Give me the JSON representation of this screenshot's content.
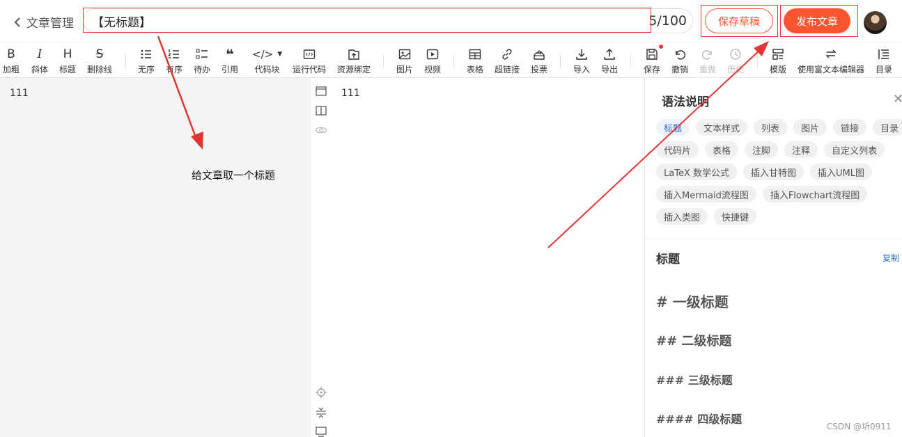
{
  "header": {
    "back_label": "文章管理",
    "title_value": "【无标题】",
    "title_count": "5/100",
    "save_draft_label": "保存草稿",
    "publish_label": "发布文章"
  },
  "toolbar": {
    "items": [
      {
        "icon": "B",
        "label": "加粗"
      },
      {
        "icon": "I",
        "label": "斜体"
      },
      {
        "icon": "H",
        "label": "标题"
      },
      {
        "icon": "S",
        "label": "删除线"
      },
      {
        "icon": "unordered-list",
        "label": "无序"
      },
      {
        "icon": "ordered-list",
        "label": "有序"
      },
      {
        "icon": "todo-list",
        "label": "待办"
      },
      {
        "icon": "quote",
        "label": "引用"
      },
      {
        "icon": "code",
        "label": "代码块"
      },
      {
        "icon": "run-code",
        "label": "运行代码"
      },
      {
        "icon": "resource-bind",
        "label": "资源绑定"
      },
      {
        "icon": "image",
        "label": "图片"
      },
      {
        "icon": "video",
        "label": "视频"
      },
      {
        "icon": "table",
        "label": "表格"
      },
      {
        "icon": "link",
        "label": "超链接"
      },
      {
        "icon": "vote",
        "label": "投票"
      },
      {
        "icon": "import",
        "label": "导入"
      },
      {
        "icon": "export",
        "label": "导出"
      },
      {
        "icon": "save",
        "label": "保存"
      },
      {
        "icon": "undo",
        "label": "撤销"
      },
      {
        "icon": "redo",
        "label": "重做"
      },
      {
        "icon": "history",
        "label": "历史"
      },
      {
        "icon": "template",
        "label": "模版"
      },
      {
        "icon": "switch",
        "label": "使用富文本编辑器"
      },
      {
        "icon": "toc",
        "label": "目录"
      }
    ]
  },
  "editor": {
    "content": "111",
    "annotation": "给文章取一个标题"
  },
  "preview": {
    "content": "111"
  },
  "panel": {
    "title": "语法说明",
    "chips": [
      "标题",
      "文本样式",
      "列表",
      "图片",
      "链接",
      "目录",
      "代码片",
      "表格",
      "注脚",
      "注释",
      "自定义列表",
      "LaTeX 数学公式",
      "插入甘特图",
      "插入UML图",
      "插入Mermaid流程图",
      "插入Flowchart流程图",
      "插入类图",
      "快捷键"
    ],
    "active_chip": "标题",
    "section_title": "标题",
    "copy_label": "复制",
    "examples": [
      "# 一级标题",
      "## 二级标题",
      "### 三级标题",
      "#### 四级标题"
    ]
  },
  "watermark": "CSDN @圻0911",
  "colors": {
    "accent": "#fc5531",
    "link": "#2f6fd4",
    "annotation": "#e33333"
  }
}
